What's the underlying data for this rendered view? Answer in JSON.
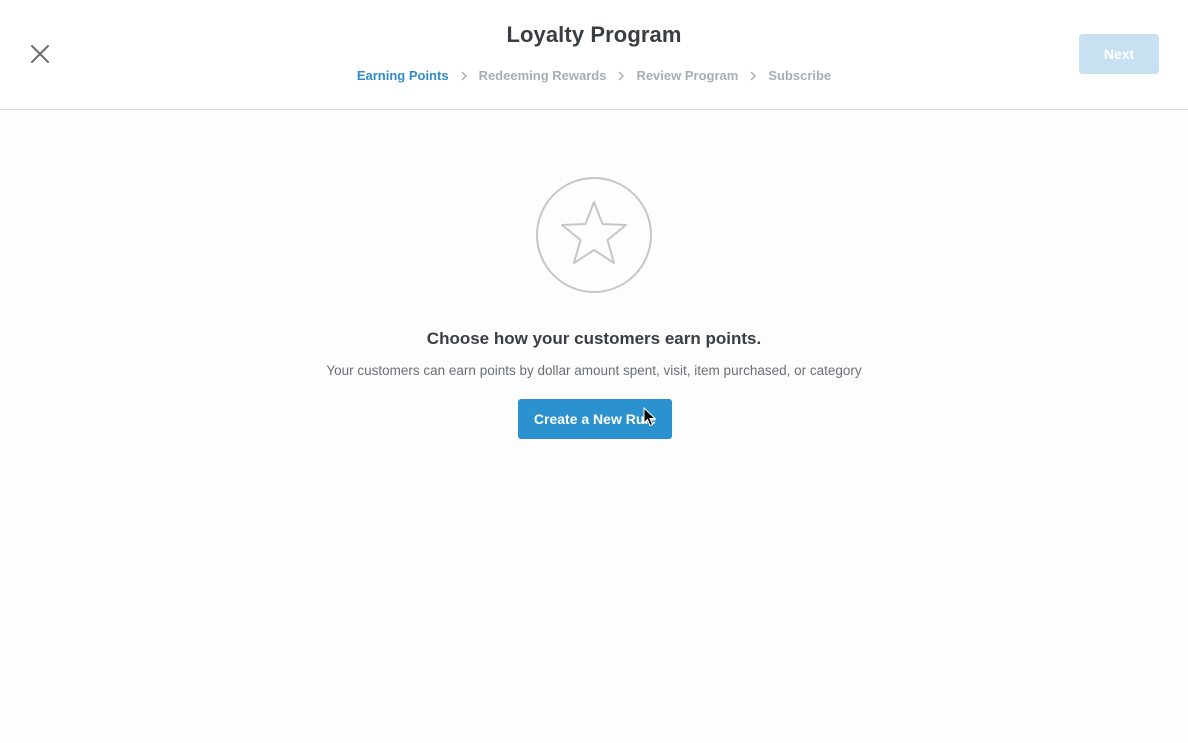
{
  "header": {
    "title": "Loyalty Program",
    "close_icon": "close-icon",
    "next_label": "Next",
    "steps": [
      {
        "label": "Earning Points",
        "active": true
      },
      {
        "label": "Redeeming Rewards",
        "active": false
      },
      {
        "label": "Review Program",
        "active": false
      },
      {
        "label": "Subscribe",
        "active": false
      }
    ]
  },
  "main": {
    "icon": "star-icon",
    "heading": "Choose how your customers earn points.",
    "description": "Your customers can earn points by dollar amount spent, visit, item purchased, or category",
    "create_button_label": "Create a New Rule"
  },
  "colors": {
    "accent": "#2b92cf",
    "active_step": "#2e8ccb",
    "next_disabled": "#c7e1f2",
    "inactive_step": "#a9adb1"
  }
}
